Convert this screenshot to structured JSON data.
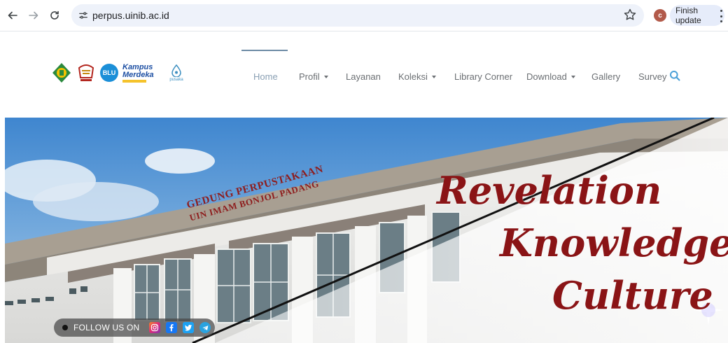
{
  "browser": {
    "url": "perpus.uinib.ac.id",
    "profile_initial": "c",
    "finish_update_label": "Finish update",
    "icons": [
      "back-icon",
      "forward-icon",
      "reload-icon",
      "site-info-icon",
      "star-icon",
      "kebab-menu-icon"
    ]
  },
  "header": {
    "logos": [
      "kemenag-logo",
      "uin-logo",
      "blu-logo",
      "kampus-merdeka-logo",
      "pusaka-logo"
    ],
    "blu_text": "BLU",
    "kampus_line1": "Kampus",
    "kampus_line2": "Merdeka",
    "pusaka_text": "pusaka",
    "nav": [
      {
        "label": "Home",
        "active": true,
        "dropdown": false
      },
      {
        "label": "Profil",
        "active": false,
        "dropdown": true
      },
      {
        "label": "Layanan",
        "active": false,
        "dropdown": false
      },
      {
        "label": "Koleksi",
        "active": false,
        "dropdown": true
      },
      {
        "label": "Library Corner",
        "active": false,
        "dropdown": false
      },
      {
        "label": "Download",
        "active": false,
        "dropdown": true
      },
      {
        "label": "Gallery",
        "active": false,
        "dropdown": false
      },
      {
        "label": "Survey",
        "active": false,
        "dropdown": false
      }
    ]
  },
  "hero": {
    "sign_line1": "GEDUNG PERPUSTAKAAN",
    "sign_line2": "UIN IMAM BONJOL PADANG",
    "tagline": [
      "Revelation",
      "Knowledge",
      "Culture"
    ],
    "follow_label": "FOLLOW US ON",
    "social": [
      "instagram-icon",
      "facebook-icon",
      "twitter-icon",
      "telegram-icon"
    ]
  },
  "colors": {
    "accent_blue": "#4aa0d8",
    "tagline_red": "#8a1416",
    "nav_text": "#6b6f73"
  }
}
